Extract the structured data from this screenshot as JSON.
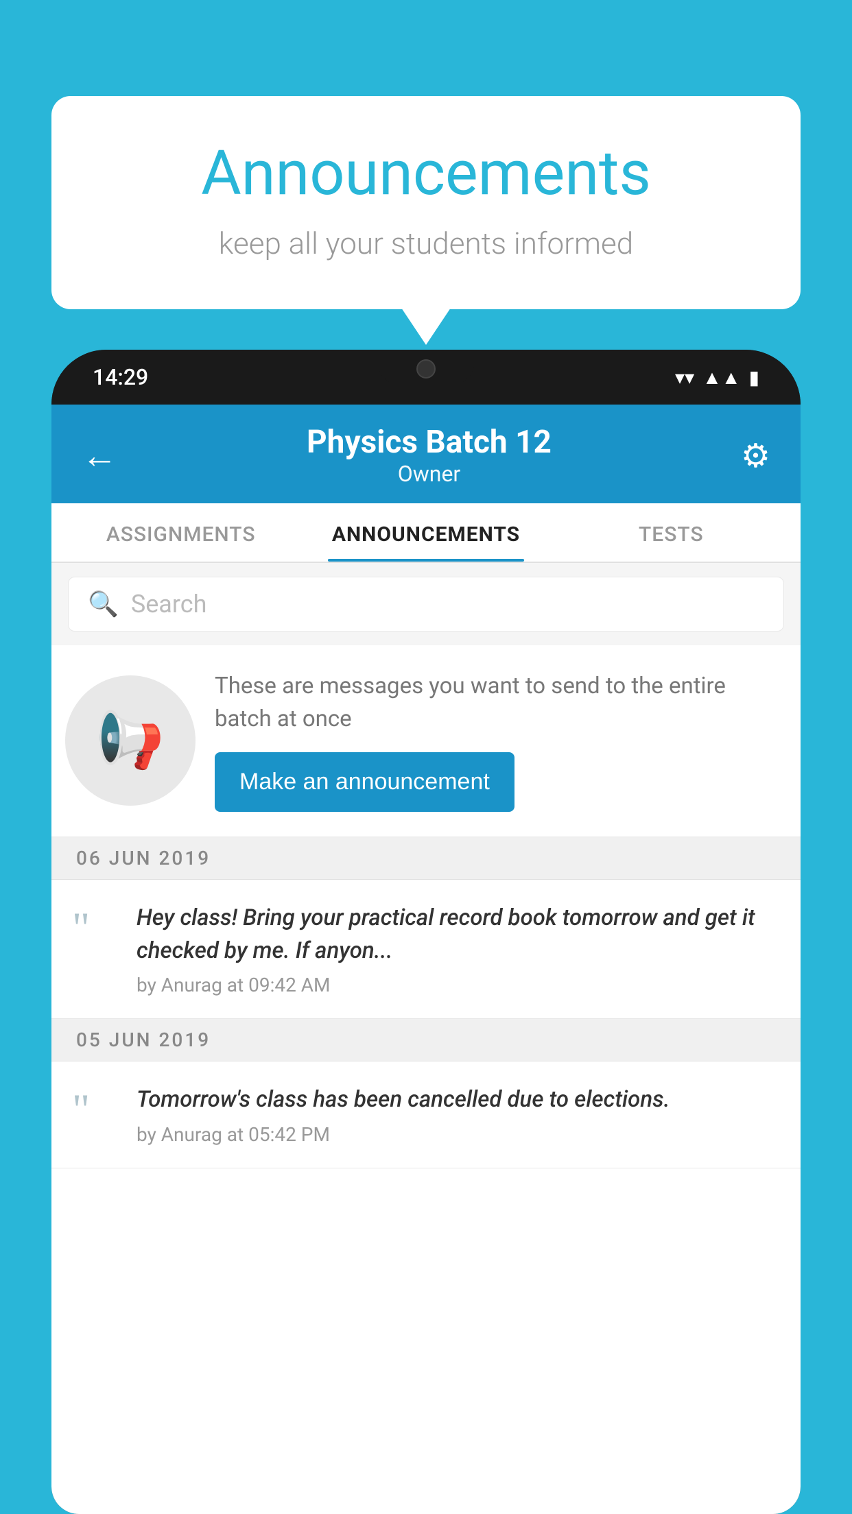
{
  "background_color": "#29B6D8",
  "speech_bubble": {
    "title": "Announcements",
    "subtitle": "keep all your students informed"
  },
  "phone": {
    "status_time": "14:29",
    "header": {
      "back_label": "←",
      "batch_name": "Physics Batch 12",
      "role": "Owner",
      "settings_icon": "⚙"
    },
    "tabs": [
      {
        "label": "ASSIGNMENTS",
        "active": false
      },
      {
        "label": "ANNOUNCEMENTS",
        "active": true
      },
      {
        "label": "TESTS",
        "active": false
      }
    ],
    "search": {
      "placeholder": "Search"
    },
    "promo": {
      "description": "These are messages you want to\nsend to the entire batch at once",
      "button_label": "Make an announcement"
    },
    "announcements": [
      {
        "date": "06  JUN  2019",
        "text": "Hey class! Bring your practical record book tomorrow and get it checked by me. If anyon...",
        "meta": "by Anurag at 09:42 AM"
      },
      {
        "date": "05  JUN  2019",
        "text": "Tomorrow's class has been cancelled due to elections.",
        "meta": "by Anurag at 05:42 PM"
      }
    ]
  }
}
